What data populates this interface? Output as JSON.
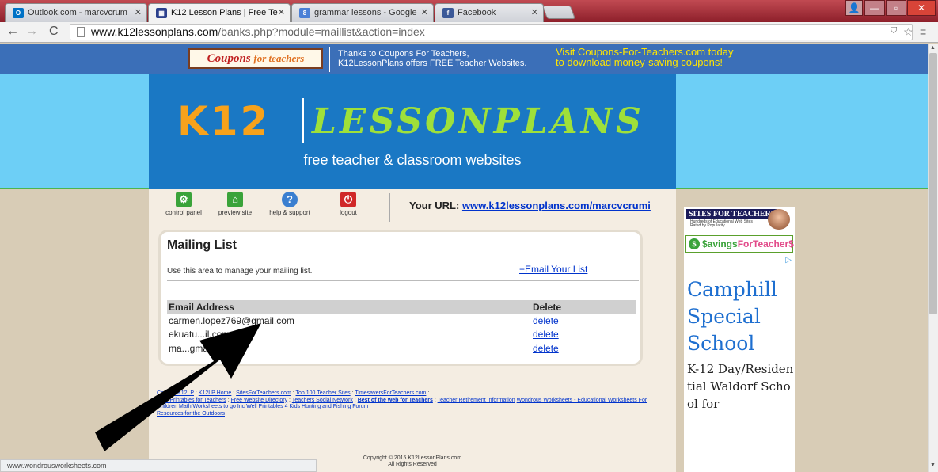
{
  "browser": {
    "tabs": [
      {
        "label": "Outlook.com - marcvcrum",
        "icon": "outlook-icon",
        "icon_text": "O",
        "color": "#0072c6"
      },
      {
        "label": "K12 Lesson Plans | Free Te",
        "icon": "k12-grid-icon",
        "icon_text": "▦",
        "color": "#2b3f8c"
      },
      {
        "label": "grammar lessons - Google",
        "icon": "google-search-icon",
        "icon_text": "8",
        "color": "#4a7fd6"
      },
      {
        "label": "Facebook",
        "icon": "facebook-icon",
        "icon_text": "f",
        "color": "#3b5998"
      }
    ],
    "url_host": "www.k12lessonplans.com",
    "url_path": "/banks.php?module=maillist&action=index",
    "status_text": "www.wondrousworksheets.com"
  },
  "top_banner": {
    "logo_main": "Coupons",
    "logo_sub": "for teachers",
    "thanks_line1": "Thanks to Coupons For Teachers,",
    "thanks_line2": "K12LessonPlans offers FREE Teacher Websites.",
    "visit_line1": "Visit Coupons-For-Teachers.com today",
    "visit_line2": "to download money-saving coupons!"
  },
  "logo": {
    "k12": "K12",
    "lessonplans": "LESSONPLANS",
    "tagline": "free teacher & classroom websites"
  },
  "control_bar": {
    "items": [
      {
        "label": "control panel",
        "icon": "gear-icon",
        "glyph": "⚙",
        "color": "#3aa33a"
      },
      {
        "label": "preview site",
        "icon": "building-icon",
        "glyph": "⌂",
        "color": "#3aa33a"
      },
      {
        "label": "help & support",
        "icon": "help-icon",
        "glyph": "?",
        "color": "#3a7fd0"
      },
      {
        "label": "logout",
        "icon": "power-icon",
        "glyph": "⏻",
        "color": "#d02828"
      }
    ],
    "your_url_label": "Your URL:",
    "your_url": "www.k12lessonplans.com/marcvcrumi"
  },
  "mailing_list": {
    "title": "Mailing List",
    "description": "Use this area to manage your mailing list.",
    "email_link": "+Email Your List",
    "columns": [
      "Email Address",
      "Delete"
    ],
    "rows": [
      {
        "email": "carmen.lopez769@gmail.com",
        "delete": "delete"
      },
      {
        "email": "ekuatu...il.com",
        "delete": "delete"
      },
      {
        "email": "ma...gmail.com",
        "delete": "delete"
      }
    ]
  },
  "footer": {
    "links": [
      "Contact K12LP",
      "K12LP Home",
      "SitesForTeachers.com",
      "Top 100 Teacher Sites",
      "TimesaversForTeachers.com",
      "Free Printables for Teachers",
      "Free Website Directory",
      "Teachers Social Network",
      "Best of the web for Teachers",
      "Teacher Retirement Information",
      "Wondrous Worksheets - Educational Worksheets For Children",
      "Math Worksheets to go",
      "Inc Well Printables 4 Kids",
      "Hunting and Fishing Forum",
      "Resources for the Outdoors"
    ],
    "copyright_line1": "Copyright © 2015 K12LessonPlans.com",
    "copyright_line2": "All Rights Reserved"
  },
  "ads": {
    "sft_title": "SITES FOR TEACHERS",
    "sft_sub": "Hundreds of Educational Web Sites Rated by Popularity",
    "savings_part1": "$avings",
    "savings_part2": "ForTeacher$",
    "ad_title": "Camphill Special School",
    "ad_body": "K-12 Day/Residential Waldorf School for"
  }
}
